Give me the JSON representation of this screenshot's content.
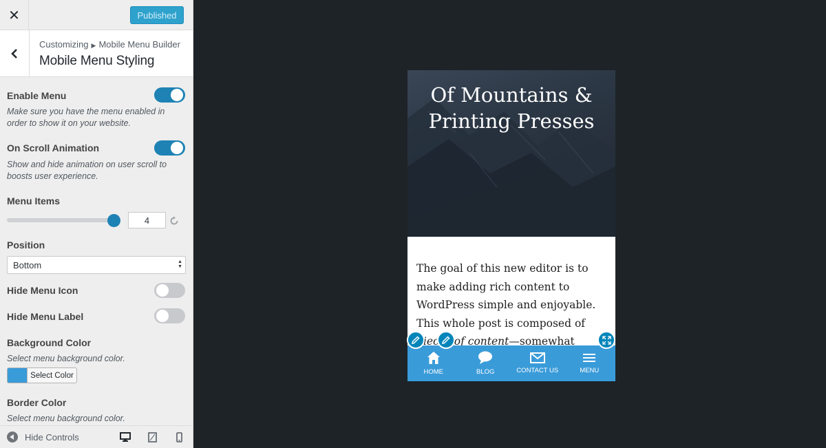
{
  "topbar": {
    "close_icon": "close-icon",
    "publish_label": "Published"
  },
  "section": {
    "breadcrumb_root": "Customizing",
    "breadcrumb_parent": "Mobile Menu Builder",
    "title": "Mobile Menu Styling"
  },
  "controls": {
    "enable_menu": {
      "label": "Enable Menu",
      "description": "Make sure you have the menu enabled in order to show it on your website.",
      "enabled": true
    },
    "scroll_animation": {
      "label": "On Scroll Animation",
      "description": "Show and hide animation on user scroll to boosts user experience.",
      "enabled": true
    },
    "menu_items": {
      "label": "Menu Items",
      "value": "4",
      "slider_max_fraction": 1.0
    },
    "position": {
      "label": "Position",
      "selected": "Bottom"
    },
    "hide_menu_icon": {
      "label": "Hide Menu Icon",
      "enabled": false
    },
    "hide_menu_label": {
      "label": "Hide Menu Label",
      "enabled": false
    },
    "background_color": {
      "label": "Background Color",
      "description": "Select menu background color.",
      "button": "Select Color",
      "color": "#3a9bd9"
    },
    "border_color": {
      "label": "Border Color",
      "description": "Select menu background color."
    }
  },
  "footer": {
    "hide_controls": "Hide Controls"
  },
  "preview": {
    "site_title_line1": "Of Mountains &",
    "site_title_line2": "Printing Presses",
    "post_part1": "The goal of this new editor is to make adding rich content to WordPress simple and enjoyable. This whole post is composed of ",
    "post_em": "pieces of content",
    "post_part2": "—somewhat similar to LEGO bricks—",
    "menu": [
      {
        "label": "HOME",
        "icon": "home-icon"
      },
      {
        "label": "BLOG",
        "icon": "chat-bubble-icon"
      },
      {
        "label": "CONTACT US",
        "icon": "envelope-icon"
      },
      {
        "label": "MENU",
        "icon": "hamburger-icon"
      }
    ]
  },
  "colors": {
    "accent": "#1e82b4",
    "menu_bg": "#3a9bd9",
    "preview_bg": "#1d2327"
  }
}
